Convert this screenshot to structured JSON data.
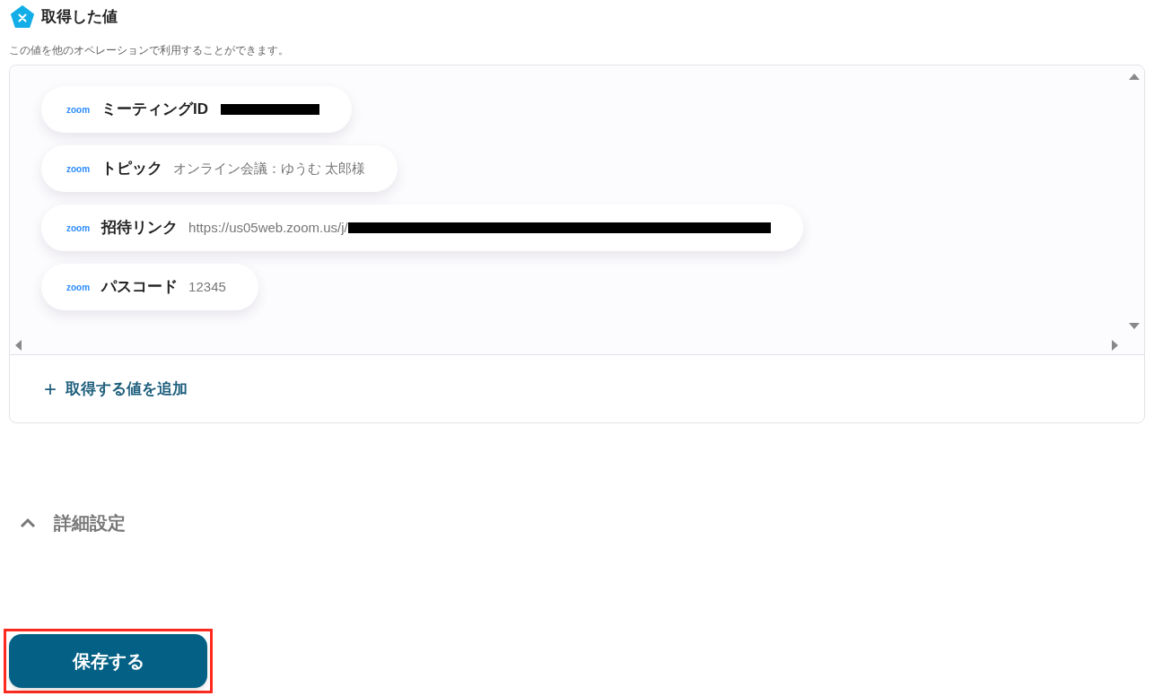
{
  "section": {
    "title": "取得した値",
    "description": "この値を他のオペレーションで利用することができます。"
  },
  "values": [
    {
      "source": "zoom",
      "label": "ミーティングID",
      "redacted": true
    },
    {
      "source": "zoom",
      "label": "トピック",
      "value": "オンライン会議：ゆうむ 太郎様",
      "redacted": false
    },
    {
      "source": "zoom",
      "label": "招待リンク",
      "value": "https://us05web.zoom.us/j/",
      "redacted": true
    },
    {
      "source": "zoom",
      "label": "パスコード",
      "value": "12345",
      "redacted": false
    }
  ],
  "add_button": {
    "icon": "+",
    "label": "取得する値を追加"
  },
  "advanced": {
    "label": "詳細設定",
    "expanded": true
  },
  "save_button": {
    "label": "保存する",
    "highlighted": true
  }
}
